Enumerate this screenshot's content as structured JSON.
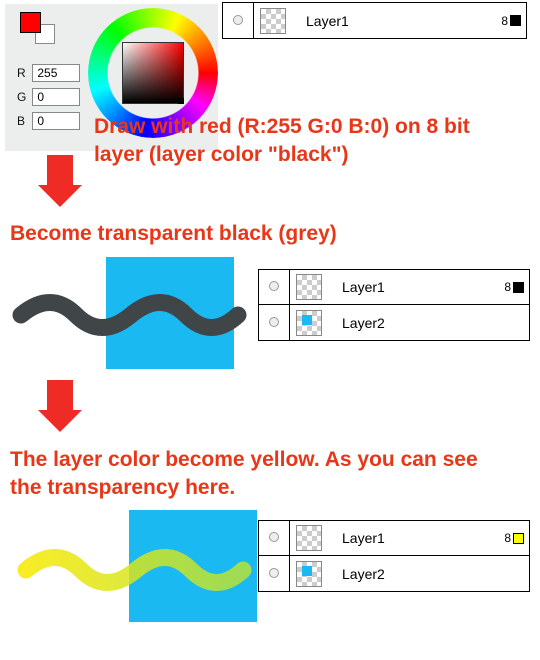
{
  "picker": {
    "r_label": "R",
    "g_label": "G",
    "b_label": "B",
    "r_value": "255",
    "g_value": "0",
    "b_value": "0",
    "primary_color": "#ff0000",
    "secondary_color": "#ffffff"
  },
  "layer_panels": {
    "top": {
      "rows": [
        {
          "name": "Layer1",
          "badge": "8",
          "badge_color": "#000000"
        }
      ]
    },
    "mid": {
      "rows": [
        {
          "name": "Layer1",
          "badge": "8",
          "badge_color": "#000000"
        },
        {
          "name": "Layer2"
        }
      ]
    },
    "bot": {
      "rows": [
        {
          "name": "Layer1",
          "badge": "8",
          "badge_color": "#ffff00"
        },
        {
          "name": "Layer2"
        }
      ]
    }
  },
  "text": {
    "step1": "Draw with red (R:255 G:0 B:0) on 8 bit layer (layer color \"black\")",
    "step2": "Become transparent black (grey)",
    "step3": "The layer color become yellow. As you can see the transparency here."
  },
  "strokes": {
    "mid_color": "#404548",
    "bot_grad_from": "#f6e900",
    "bot_grad_to": "#b6e23a"
  }
}
